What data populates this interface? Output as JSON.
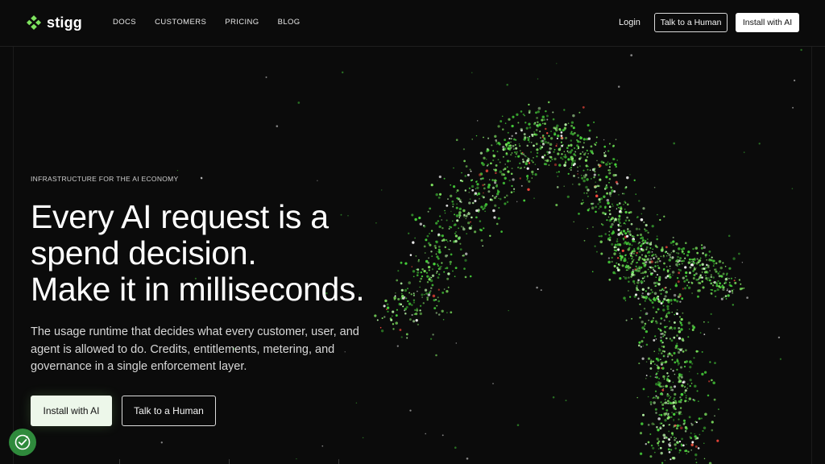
{
  "brand": {
    "name": "stigg",
    "accent": "#7ee35f",
    "particle_colors": [
      "#46d13a",
      "#7ee35f",
      "#b8f5a6",
      "#ffffff",
      "#ff4a3d"
    ]
  },
  "nav": {
    "items": [
      "DOCS",
      "CUSTOMERS",
      "PRICING",
      "BLOG"
    ],
    "login": "Login",
    "talk": "Talk to a Human",
    "install": "Install with AI"
  },
  "hero": {
    "eyebrow": "INFRASTRUCTURE FOR THE AI ECONOMY",
    "headline_lines": [
      "Every AI request is a",
      "spend decision.",
      "Make it in milliseconds."
    ],
    "subcopy": "The usage runtime that decides what every customer, user, and agent is allowed to do. Credits, entitlements, metering, and governance in a single enforcement layer.",
    "primary_cta": "Install with AI",
    "secondary_cta": "Talk to a Human"
  },
  "icons": {
    "logo": "stigg-logo-icon",
    "cookie": "cookie-consent-icon"
  }
}
